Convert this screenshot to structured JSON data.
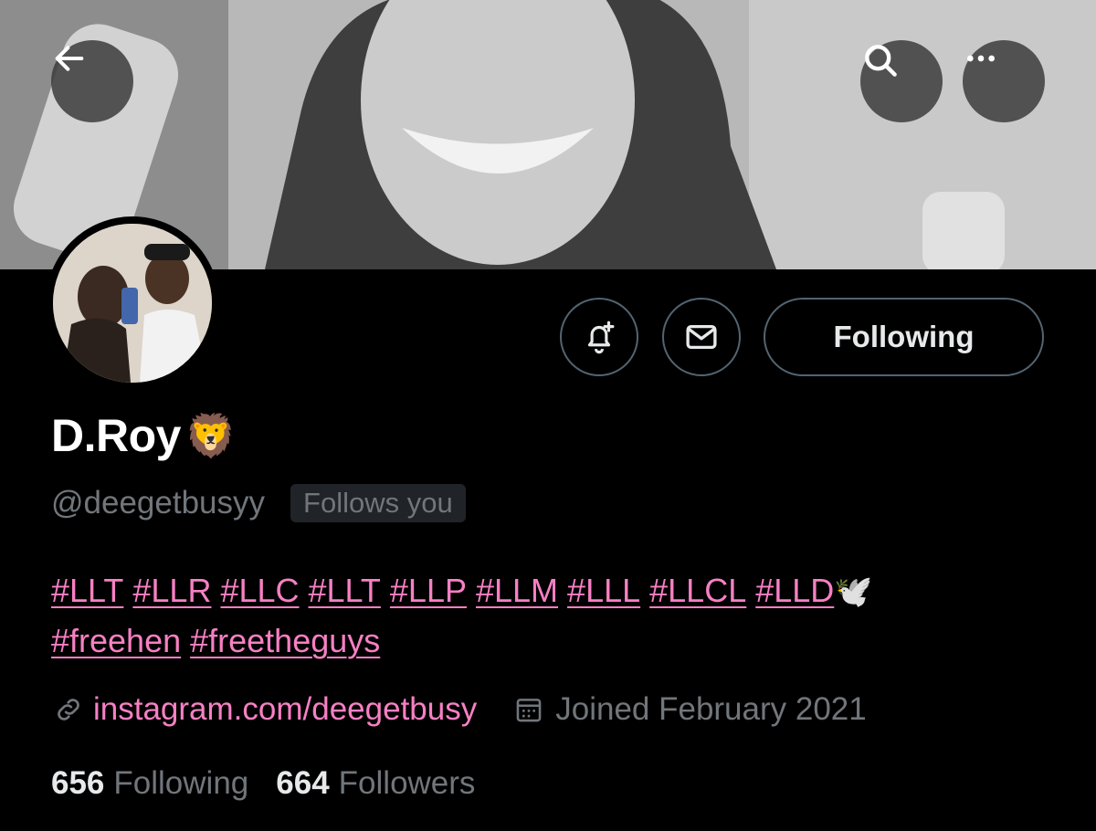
{
  "header": {
    "back_icon": "arrow-left-icon",
    "search_icon": "search-icon",
    "more_icon": "more-horizontal-icon"
  },
  "profile": {
    "display_name": "D.Roy",
    "name_emoji": "🦁",
    "handle": "@deegetbusyy",
    "follows_you": "Follows you"
  },
  "actions": {
    "notify_icon": "bell-plus-icon",
    "message_icon": "envelope-icon",
    "following_label": "Following"
  },
  "bio": {
    "line1_tags": [
      "#LLT",
      "#LLR",
      "#LLC",
      "#LLT",
      "#LLP",
      "#LLM",
      "#LLL",
      "#LLCL",
      "#LLD"
    ],
    "line1_emoji": "🕊️",
    "line2_tags": [
      "#freehen",
      "#freetheguys"
    ]
  },
  "meta": {
    "link_icon": "link-icon",
    "website": "instagram.com/deegetbusy",
    "calendar_icon": "calendar-icon",
    "joined": "Joined February 2021"
  },
  "stats": {
    "following_count": "656",
    "following_label": "Following",
    "followers_count": "664",
    "followers_label": "Followers"
  },
  "colors": {
    "accent_pink": "#f780c4",
    "muted_text": "#71767b",
    "border": "#536471",
    "background": "#000000"
  }
}
